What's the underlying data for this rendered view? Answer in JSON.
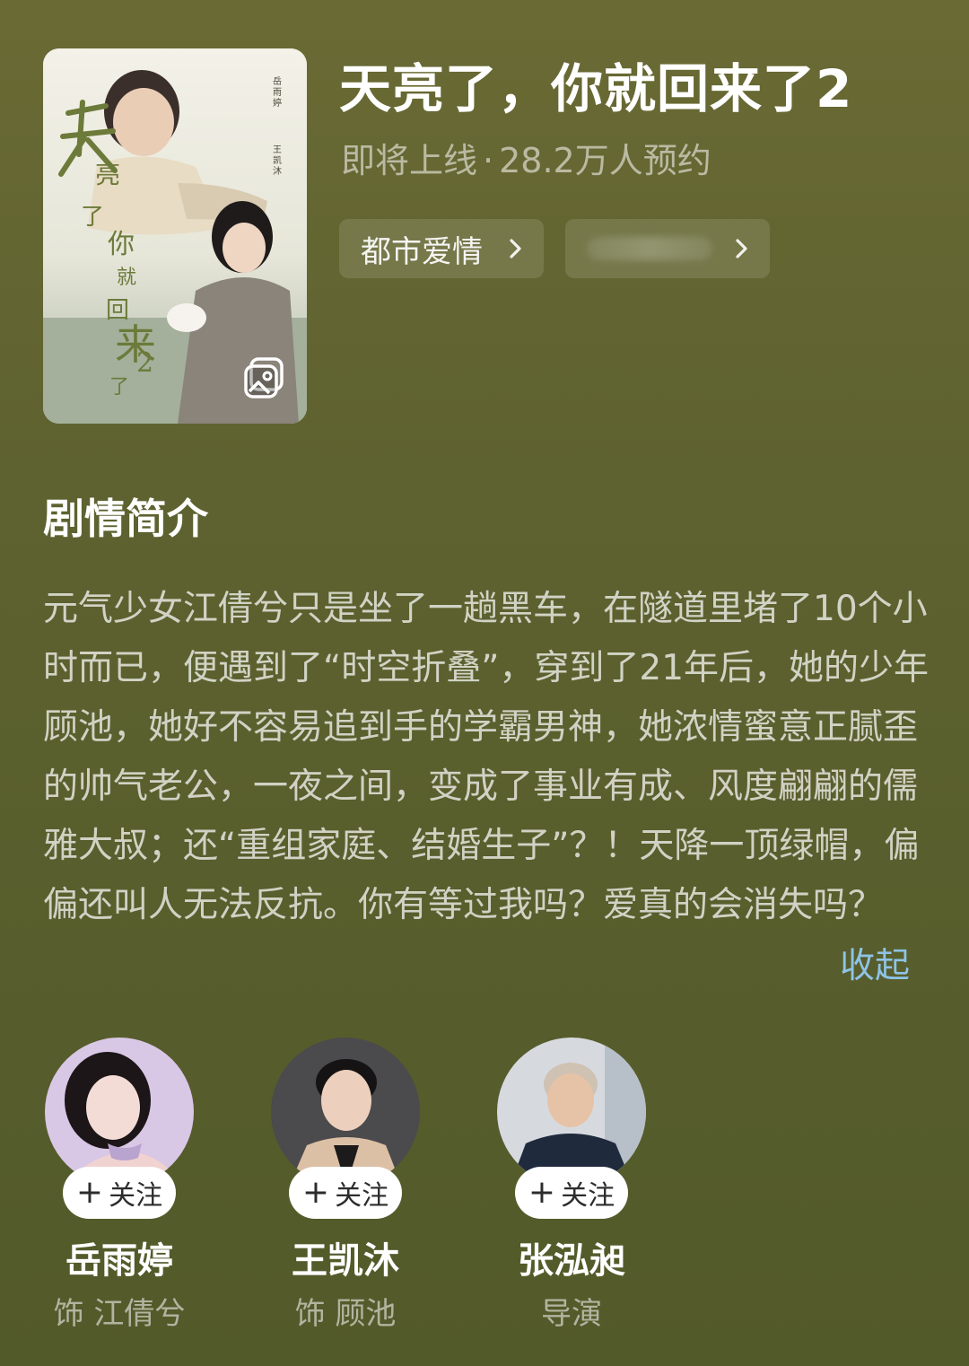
{
  "show": {
    "title": "天亮了，你就回来了2",
    "status": "即将上线",
    "separator": "·",
    "reservations": "28.2万人预约",
    "tags": [
      {
        "label": "都市爱情",
        "icon": "chevron-right-icon"
      },
      {
        "label": "",
        "icon": "chevron-right-icon"
      }
    ]
  },
  "poster": {
    "alt_icon": "gallery-photo-icon"
  },
  "synopsis": {
    "heading": "剧情简介",
    "text": "元气少女江倩兮只是坐了一趟黑车，在隧道里堵了10个小时而已，便遇到了“时空折叠”，穿到了21年后，她的少年顾池，她好不容易追到手的学霸男神，她浓情蜜意正腻歪的帅气老公，一夜之间，变成了事业有成、风度翩翩的儒雅大叔；还“重组家庭、结婚生子”？！天降一顶绿帽，偏偏还叫人无法反抗。你有等过我吗？爱真的会消失吗？",
    "collapse_label": "收起"
  },
  "cast": [
    {
      "name": "岳雨婷",
      "role": "饰 江倩兮",
      "follow_label": "关注",
      "follow_icon": "plus-icon"
    },
    {
      "name": "王凯沐",
      "role": "饰 顾池",
      "follow_label": "关注",
      "follow_icon": "plus-icon"
    },
    {
      "name": "张泓昶",
      "role": "导演",
      "follow_label": "关注",
      "follow_icon": "plus-icon"
    }
  ],
  "colors": {
    "background": "#5e6230",
    "link": "#8ec3e6",
    "follow_button": "#ffffff"
  }
}
